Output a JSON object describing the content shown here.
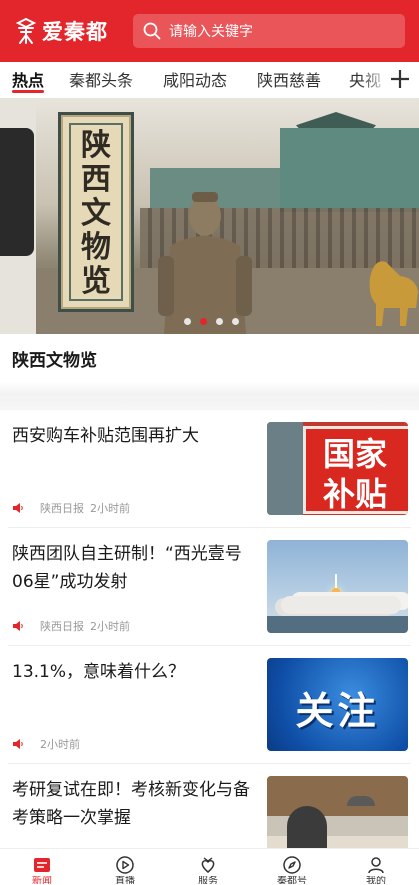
{
  "header": {
    "logo_text": "爱秦都",
    "search_placeholder": "请输入关键字",
    "brand_color": "#e3262b"
  },
  "tabs": [
    {
      "label": "热点",
      "active": true
    },
    {
      "label": "秦都头条",
      "active": false
    },
    {
      "label": "咸阳动态",
      "active": false
    },
    {
      "label": "陕西慈善",
      "active": false
    },
    {
      "label": "央视",
      "active": false
    }
  ],
  "tabs_add_icon": "plus-icon",
  "banner": {
    "image_text": "陕西文物览",
    "caption": "陕西文物览",
    "slide_count": 4,
    "active_slide": 2
  },
  "news": [
    {
      "title": "西安购车补贴范围再扩大",
      "source": "陕西日报",
      "time": "2小时前",
      "thumb_text": "国家补贴"
    },
    {
      "title": "陕西团队自主研制！“西光壹号06星”成功发射",
      "source": "陕西日报",
      "time": "2小时前",
      "thumb_text": ""
    },
    {
      "title": "13.1%，意味着什么？",
      "source": "",
      "time": "2小时前",
      "thumb_text": "关注"
    },
    {
      "title": "考研复试在即！考核新变化与备考策略一次掌握",
      "source": "",
      "time": "",
      "thumb_text": ""
    }
  ],
  "bottom_nav": [
    {
      "label": "新闻",
      "icon": "news-icon",
      "active": true
    },
    {
      "label": "直播",
      "icon": "play-icon",
      "active": false
    },
    {
      "label": "服务",
      "icon": "service-icon",
      "active": false
    },
    {
      "label": "秦都号",
      "icon": "compass-icon",
      "active": false
    },
    {
      "label": "我的",
      "icon": "user-icon",
      "active": false
    }
  ]
}
